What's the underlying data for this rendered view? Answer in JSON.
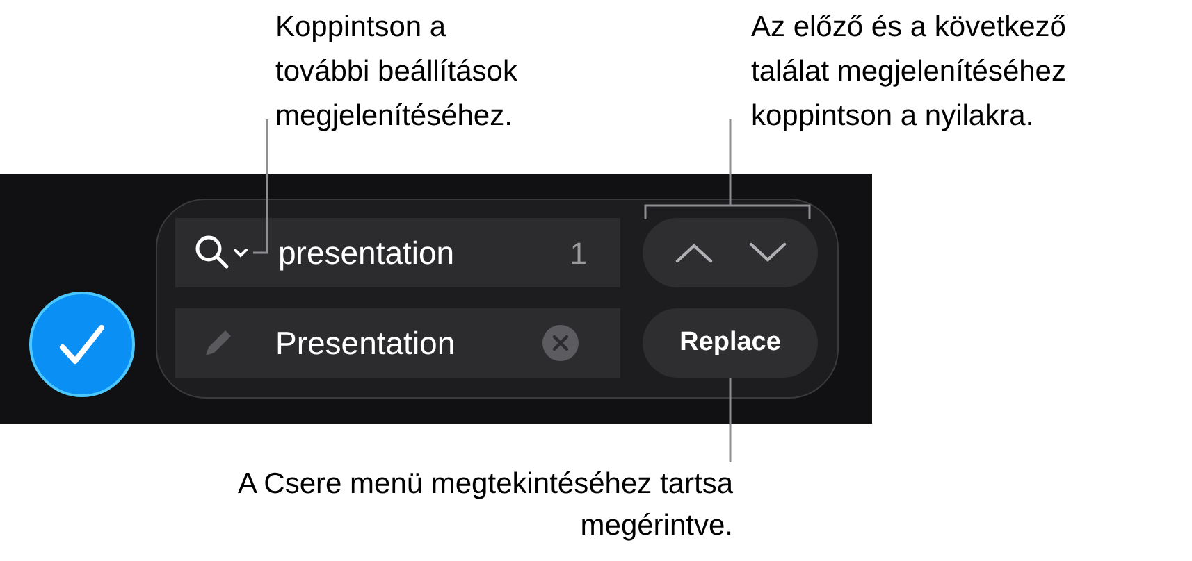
{
  "callouts": {
    "options": "Koppintson a\ntovábbi beállítások\nmegjelenítéséhez.",
    "arrows": "Az előző és a következő\ntalálat megjelenítéséhez\nkoppintson a nyilakra.",
    "replace": "A Csere menü megtekintéséhez tartsa\nmegérintve."
  },
  "search": {
    "value": "presentation",
    "count": "1"
  },
  "replace": {
    "value": "Presentation"
  },
  "replace_button": "Replace"
}
